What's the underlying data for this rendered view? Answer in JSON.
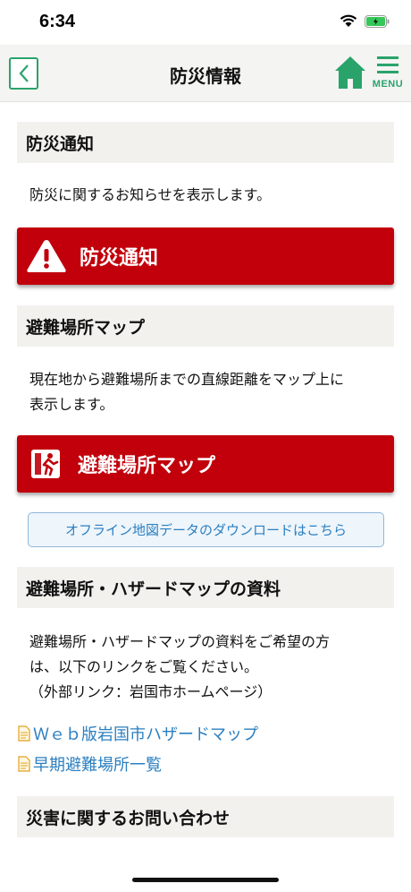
{
  "status_bar": {
    "time": "6:34"
  },
  "nav": {
    "title": "防災情報",
    "menu_label": "MENU"
  },
  "sections": {
    "notice": {
      "header": "防災通知",
      "description": "防災に関するお知らせを表示します。",
      "button_label": "防災通知"
    },
    "shelter_map": {
      "header": "避難場所マップ",
      "description_line1": "現在地から避難場所までの直線距離をマップ上に",
      "description_line2": "表示します。",
      "button_label": "避難場所マップ",
      "offline_link": "オフライン地図データのダウンロードはこちら"
    },
    "hazard_docs": {
      "header": "避難場所・ハザードマップの資料",
      "description_line1": "避難場所・ハザードマップの資料をご希望の方",
      "description_line2": "は、以下のリンクをご覧ください。",
      "description_line3": "（外部リンク：岩国市ホームページ）",
      "links": [
        "Ｗｅｂ版岩国市ハザードマップ",
        "早期避難場所一覧"
      ]
    },
    "inquiry": {
      "header": "災害に関するお問い合わせ"
    }
  },
  "colors": {
    "accent_green": "#2aa36b",
    "alert_red": "#c1000b",
    "link_blue": "#2b7fc0",
    "section_bg": "#f2f1ee"
  }
}
